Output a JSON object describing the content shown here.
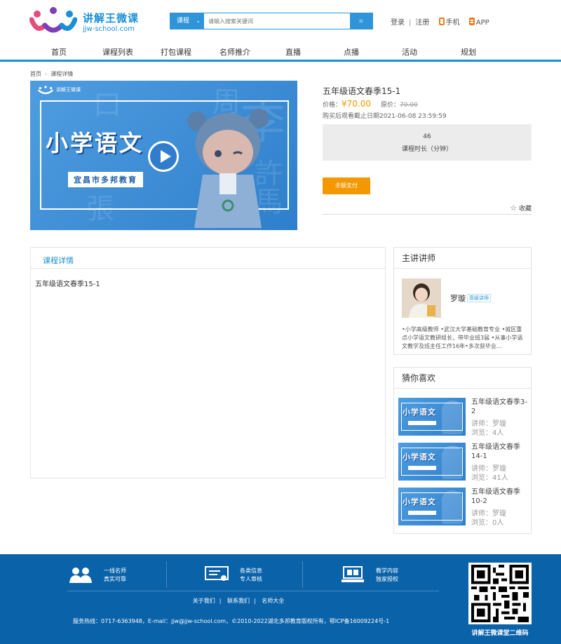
{
  "header": {
    "logo_cn": "讲解王微课",
    "logo_en": "jjw-school.com",
    "search": {
      "category": "课程",
      "placeholder": "请输入搜索关键词"
    },
    "login": "登录",
    "register": "注册",
    "mobile": "手机",
    "app": "APP"
  },
  "nav": [
    "首页",
    "课程列表",
    "打包课程",
    "名师推介",
    "直播",
    "点播",
    "活动",
    "规划"
  ],
  "breadcrumb": [
    "首页",
    "课程详情"
  ],
  "banner": {
    "logo": "讲解王微课",
    "title": "小学语文",
    "subtitle": "宜昌市多邦教育"
  },
  "course": {
    "title": "五年级语文春季15-1",
    "price_label": "价格：",
    "price": "¥70.00",
    "orig_label": "原价：",
    "orig_price": "70.00",
    "deadline": "购买后观看截止日期2021-06-08 23:59:59",
    "duration": "46",
    "duration_label": "课程时长（分钟）",
    "pay_button": "余额支付",
    "favorite": "收藏"
  },
  "detail": {
    "tab": "课程详情",
    "text": "五年级语文春季15-1"
  },
  "teacher": {
    "heading": "主讲讲师",
    "name": "罗璇",
    "badge": "高级讲师",
    "bio": "•小学高级教师 •武汉大学基础教育专业 •城区重点小学语文教研组长，带毕业班3届 •从事小学语文教学及班主任工作16年•多次获毕业..."
  },
  "recommend": {
    "heading": "猜你喜欢",
    "thumb_title": "小学语文",
    "items": [
      {
        "title": "五年级语文春季3-2",
        "teacher": "讲师：罗璇",
        "views": "浏览：4人"
      },
      {
        "title": "五年级语文春季14-1",
        "teacher": "讲师：罗璇",
        "views": "浏览：41人"
      },
      {
        "title": "五年级语文春季10-2",
        "teacher": "讲师：罗璇",
        "views": "浏览：0人"
      }
    ]
  },
  "footer": {
    "features": [
      {
        "line1": "一线名师",
        "line2": "真实可靠"
      },
      {
        "line1": "各类信息",
        "line2": "专人审核"
      },
      {
        "line1": "教学内容",
        "line2": "独家授权"
      }
    ],
    "links": [
      "关于我们",
      "联系我们",
      "名师大全"
    ],
    "info": "服务热线：0717-6363948，E-mail：jjw@jjw-school.com，©2010-2022湖北多邦教育版权所有，鄂ICP备16009224号-1",
    "qr_caption": "讲解王微课堂二维码"
  },
  "colors": {
    "brand_blue": "#1b8fd6",
    "accent_orange": "#f39800",
    "footer_blue": "#0a62a9"
  }
}
